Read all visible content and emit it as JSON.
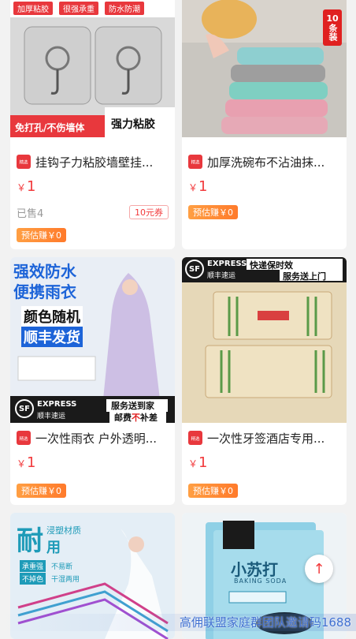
{
  "products": [
    {
      "title": "挂钩子力粘胶墙壁挂...",
      "price": "1",
      "sold": "已售4",
      "coupon": "10元券",
      "earn": "预估赚￥0",
      "image_texts": [
        "加厚粘胶",
        "很强承重",
        "防水防潮",
        "免打孔/不伤墙体",
        "强力粘胶"
      ]
    },
    {
      "title": "加厚洗碗布不沾油抹...",
      "price": "1",
      "earn": "预估赚￥0",
      "image_texts": [
        "10",
        "条装"
      ]
    },
    {
      "title": "一次性雨衣 户外透明...",
      "price": "1",
      "earn": "预估赚￥0",
      "image_texts": [
        "强效防水",
        "便携雨衣",
        "颜色随机",
        "顺丰发货",
        "EXPRESS",
        "顺丰速运",
        "服务送到家",
        "邮费",
        "不",
        "补差"
      ]
    },
    {
      "title": "一次性牙签酒店专用...",
      "price": "1",
      "earn": "预估赚￥0",
      "image_texts": [
        "EXPRESS",
        "顺丰速运",
        "快递保时效",
        "服务送上门"
      ]
    },
    {
      "image_texts": [
        "耐",
        "用",
        "浸塑材质",
        "承重强",
        "不易断",
        "不掉色",
        "干湿两用"
      ]
    },
    {
      "image_texts": [
        "小苏打",
        "BAKING SODA"
      ]
    }
  ],
  "common": {
    "currency": "￥",
    "shop_icon_label": "精选"
  },
  "footer": {
    "watermark": "高佣联盟家庭群团队邀请码1688"
  },
  "colors": {
    "price_red": "#f23a3c",
    "earn_orange": "#ff8a33",
    "background": "#f2f2f2"
  }
}
